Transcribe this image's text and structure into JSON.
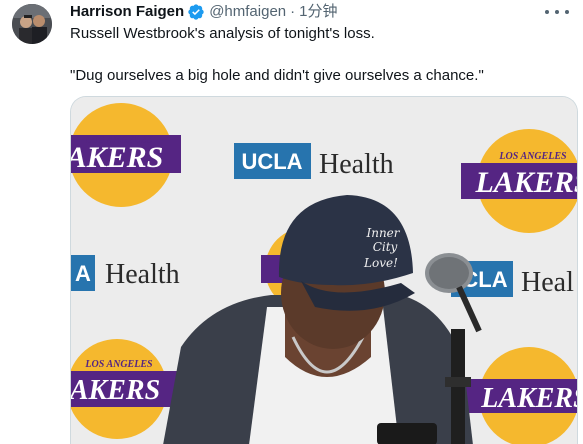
{
  "tweet": {
    "author_name": "Harrison Faigen",
    "handle": "@hmfaigen",
    "separator": "·",
    "time": "1分钟",
    "line1": "Russell Westbrook's analysis of tonight's loss.",
    "line2": "\"Dug ourselves a big hole and didn't give ourselves a chance.\""
  },
  "media": {
    "backdrop": {
      "sponsor_ucla": "UCLA",
      "sponsor_health": "Health",
      "sponsor_partial_a": "A",
      "sponsor_partial_cla": "CLA",
      "sponsor_partial_heal": "Heal",
      "team_small": "LOS ANGELES",
      "team_big": "LAKERS",
      "team_partial_big": "AKERS"
    },
    "cap_text_1": "Inner",
    "cap_text_2": "City",
    "cap_text_3": "Love!"
  },
  "colors": {
    "lakers_purple": "#552583",
    "lakers_gold": "#f5b82e",
    "ucla_blue": "#2774ae",
    "verified_blue": "#1d9bf0",
    "cap_navy": "#2b3346"
  }
}
